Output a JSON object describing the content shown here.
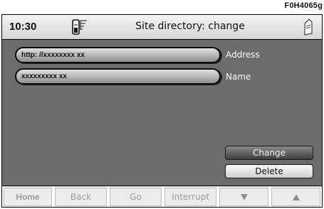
{
  "figure_code": "F0H4065g",
  "header": {
    "time": "10:30",
    "title": "Site directory: change",
    "signal_icon": "signal-strength-icon",
    "phone_icon": "phone-icon"
  },
  "fields": [
    {
      "value": "http: //xxxxxxxx  xx",
      "label": "Address"
    },
    {
      "value": "xxxxxxxxx  xx",
      "label": "Name"
    }
  ],
  "buttons": {
    "change": "Change",
    "delete": "Delete"
  },
  "softkeys": [
    {
      "label": "Home"
    },
    {
      "label": "Back"
    },
    {
      "label": "Go"
    },
    {
      "label": "Interrupt"
    },
    {
      "icon": "arrow-down-icon"
    },
    {
      "icon": "arrow-up-icon"
    }
  ],
  "colors": {
    "screen_bg": "#6c6c6c",
    "active_button": "#555555",
    "softkey_text": "#9c9c9c"
  }
}
